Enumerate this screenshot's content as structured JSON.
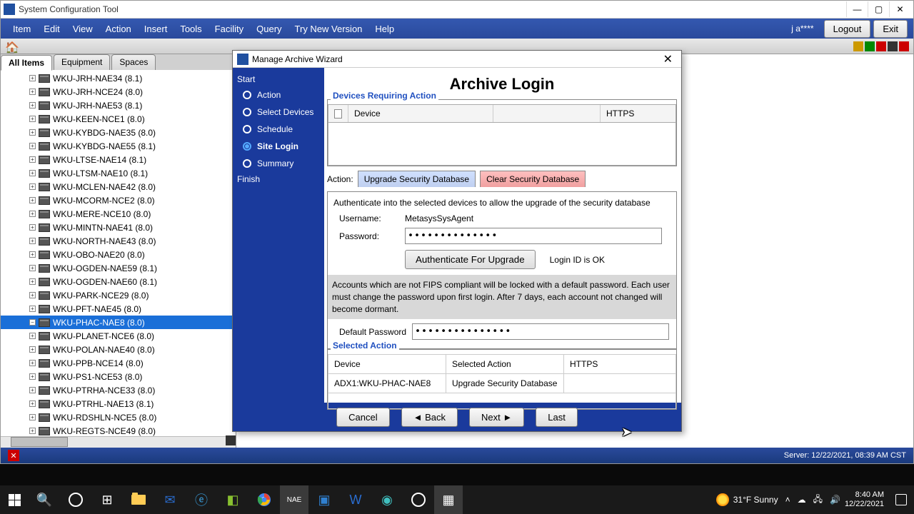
{
  "app": {
    "title": "System Configuration Tool",
    "user": "j a****"
  },
  "menu": [
    "Item",
    "Edit",
    "View",
    "Action",
    "Insert",
    "Tools",
    "Facility",
    "Query",
    "Try New Version",
    "Help"
  ],
  "app_buttons": {
    "logout": "Logout",
    "exit": "Exit"
  },
  "tabs": {
    "all": "All Items",
    "equipment": "Equipment",
    "spaces": "Spaces"
  },
  "tree_items": [
    "WKU-JRH-NAE34 (8.1)",
    "WKU-JRH-NCE24 (8.0)",
    "WKU-JRH-NAE53 (8.1)",
    "WKU-KEEN-NCE1 (8.0)",
    "WKU-KYBDG-NAE35 (8.0)",
    "WKU-KYBDG-NAE55 (8.1)",
    "WKU-LTSE-NAE14 (8.1)",
    "WKU-LTSM-NAE10 (8.1)",
    "WKU-MCLEN-NAE42 (8.0)",
    "WKU-MCORM-NCE2 (8.0)",
    "WKU-MERE-NCE10 (8.0)",
    "WKU-MINTN-NAE41 (8.0)",
    "WKU-NORTH-NAE43 (8.0)",
    "WKU-OBO-NAE20 (8.0)",
    "WKU-OGDEN-NAE59 (8.1)",
    "WKU-OGDEN-NAE60 (8.1)",
    "WKU-PARK-NCE29 (8.0)",
    "WKU-PFT-NAE45 (8.0)",
    "WKU-PHAC-NAE8 (8.0)",
    "WKU-PLANET-NCE6 (8.0)",
    "WKU-POLAN-NAE40 (8.0)",
    "WKU-PPB-NCE14 (8.0)",
    "WKU-PS1-NCE53 (8.0)",
    "WKU-PTRHA-NCE33 (8.0)",
    "WKU-PTRHL-NAE13 (8.1)",
    "WKU-RDSHLN-NCE5 (8.0)",
    "WKU-REGTS-NCE49 (8.0)"
  ],
  "tree_selected_index": 18,
  "wizard": {
    "title": "Manage Archive Wizard",
    "heading": "Archive Login",
    "nav_start": "Start",
    "nav_finish": "Finish",
    "steps": [
      "Action",
      "Select Devices",
      "Schedule",
      "Site Login",
      "Summary"
    ],
    "current_step": 3,
    "devices_label": "Devices Requiring Action",
    "dev_cols": {
      "device": "Device",
      "https": "HTTPS"
    },
    "action_label": "Action:",
    "action_tabs": {
      "upgrade": "Upgrade Security Database",
      "clear": "Clear Security Database"
    },
    "auth_note": "Authenticate into the selected devices to allow the upgrade of the security database",
    "username_label": "Username:",
    "username_value": "MetasysSysAgent",
    "password_label": "Password:",
    "password_value": "**************",
    "auth_button": "Authenticate For Upgrade",
    "auth_status": "Login ID is OK",
    "warning": "Accounts which are not FIPS compliant will be locked with a default password. Each user must change the password upon first login. After 7 days, each account not changed will become dormant.",
    "default_pw_label": "Default Password",
    "default_pw_value": "**************|",
    "selected_label": "Selected Action",
    "sel_cols": {
      "device": "Device",
      "action": "Selected Action",
      "https": "HTTPS"
    },
    "sel_row": {
      "device": "ADX1:WKU-PHAC-NAE8",
      "action": "Upgrade Security Database",
      "https": ""
    },
    "buttons": {
      "cancel": "Cancel",
      "back": "◄  Back",
      "next": "Next  ►",
      "last": "Last"
    }
  },
  "status": {
    "server": "Server: 12/22/2021, 08:39 AM CST"
  },
  "taskbar": {
    "weather": "31°F  Sunny",
    "time": "8:40 AM",
    "date": "12/22/2021"
  }
}
